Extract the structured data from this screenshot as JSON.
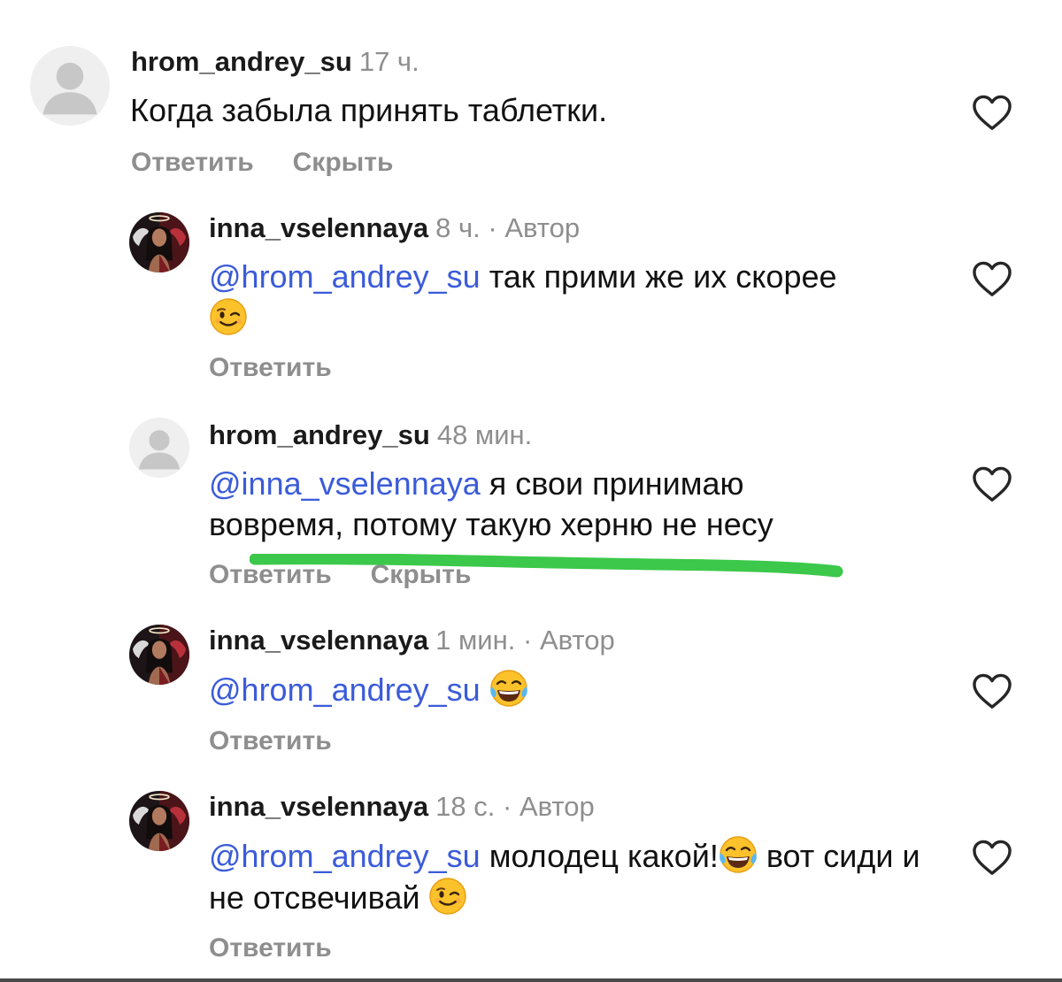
{
  "comments": [
    {
      "username": "hrom_andrey_su",
      "time": "17 ч.",
      "text": "Когда забыла принять таблетки.",
      "reply_label": "Ответить",
      "hide_label": "Скрыть"
    },
    {
      "username": "inna_vselennaya",
      "time": "8 ч.",
      "separator": "·",
      "author_label": "Автор",
      "mention": "@hrom_andrey_su",
      "text": " так прими же их скорее",
      "emoji": "wink-emoji",
      "reply_label": "Ответить"
    },
    {
      "username": "hrom_andrey_su",
      "time": "48 мин.",
      "mention": "@inna_vselennaya",
      "text": " я свои принимаю вовремя, потому такую херню не несу",
      "reply_label": "Ответить",
      "hide_label": "Скрыть"
    },
    {
      "username": "inna_vselennaya",
      "time": "1 мин.",
      "separator": "·",
      "author_label": "Автор",
      "mention": "@hrom_andrey_su",
      "emoji": "tears-of-joy-emoji",
      "reply_label": "Ответить"
    },
    {
      "username": "inna_vselennaya",
      "time": "18 с.",
      "separator": "·",
      "author_label": "Автор",
      "mention": "@hrom_andrey_su",
      "text_part1": " молодец какой!",
      "text_part2": " вот сиди и не отсвечивай ",
      "emoji1": "tears-of-joy-emoji",
      "emoji2": "wink-emoji",
      "reply_label": "Ответить"
    }
  ],
  "colors": {
    "mention": "#3b5bd9",
    "muted": "#8e8e8e",
    "highlight_stroke": "#3cc84a"
  }
}
